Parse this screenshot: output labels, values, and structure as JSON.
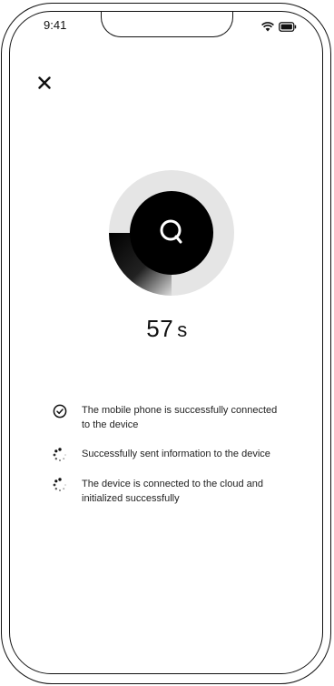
{
  "status_bar": {
    "time": "9:41"
  },
  "timer": {
    "value": "57",
    "unit": "s"
  },
  "steps": [
    {
      "label": "The mobile phone is successfully connected to the device",
      "state": "done"
    },
    {
      "label": "Successfully sent information to the device",
      "state": "loading"
    },
    {
      "label": "The device is connected to the cloud and initialized successfully",
      "state": "loading"
    }
  ],
  "icons": {
    "close": "close-icon",
    "center": "search-icon",
    "wifi": "wifi-icon",
    "battery": "battery-icon"
  },
  "colors": {
    "ink": "#111111",
    "ring": "#e5e5e5"
  }
}
